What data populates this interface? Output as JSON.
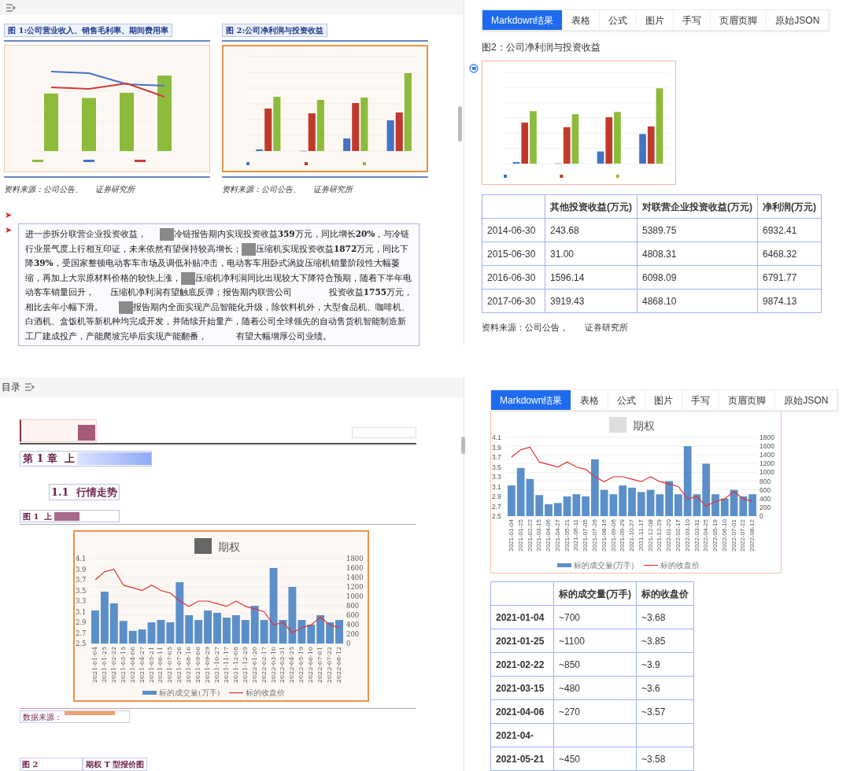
{
  "top_left": {
    "figures": [
      {
        "kind": "combo",
        "title": "图 1:公司营业收入、销售毛利率、期间费用率",
        "source": "资料来源：公司公告、     证券研究所"
      },
      {
        "kind": "bar",
        "title": "图 2:公司净利润与投资收益",
        "source": "资料来源：公司公告、     证券研究所"
      }
    ],
    "bullets": [
      {
        "marker": "➤"
      },
      {
        "marker": "➤",
        "segments": [
          {
            "kind": "text",
            "text": "进一步拆分联营企业投资收益，     "
          },
          {
            "kind": "redacted"
          },
          {
            "kind": "text",
            "text": "冷链报告期内实现投资收益**359**万元，同比增长**20%**，与冷链行业景气度上行相互印证，未来依然有望保持较高增长；"
          },
          {
            "kind": "redacted"
          },
          {
            "kind": "text",
            "text": "压缩机实现投资收益**1872**万元，同比下降**39%**，受国家整顿电动客车市场及调低补贴冲击，电动客车用卧式涡旋压缩机销量阶段性大幅萎缩，再加上大宗原材料价格的较快上涨，"
          },
          {
            "kind": "redacted"
          },
          {
            "kind": "text",
            "text": "压缩机净利润同比出现较大下降符合预期，随着下半年电动客车销量回升，      压缩机净利润有望触底反弹；报告期内联营公司              投资收益**1755**万元，相比去年小幅下滑。      "
          },
          {
            "kind": "redacted"
          },
          {
            "kind": "text",
            "text": "报告期内全面实现产品智能化升级，除饮料机外，大型食品机、咖啡机、白酒机、盒饭机等新机种均完成开发，并陆续开始量产，随着公司全球领先的自动售货机智能制造新工厂建成投产，产能爬坡完毕后实现产能翻番，           有望大幅增厚公司业绩。"
          }
        ]
      }
    ]
  },
  "top_right": {
    "tabs": [
      {
        "label": "Markdown结果",
        "selected": true
      },
      {
        "label": "表格",
        "selected": false
      },
      {
        "label": "公式",
        "selected": false
      },
      {
        "label": "图片",
        "selected": false
      },
      {
        "label": "手写",
        "selected": false
      },
      {
        "label": "页眉页脚",
        "selected": false
      },
      {
        "label": "原始JSON",
        "selected": false
      }
    ],
    "heading": "图2：公司净利润与投资收益",
    "table": {
      "columns": [
        "其他投资收益(万元)",
        "对联营企业投资收益(万元)",
        "净利润(万元)"
      ],
      "rows": [
        {
          "label": "2014-06-30",
          "cells": [
            "243.68",
            "5389.75",
            "6932.41"
          ]
        },
        {
          "label": "2015-06-30",
          "cells": [
            "31.00",
            "4808.31",
            "6468.32"
          ]
        },
        {
          "label": "2016-06-30",
          "cells": [
            "1596.14",
            "6098.09",
            "6791.77"
          ]
        },
        {
          "label": "2017-06-30",
          "cells": [
            "3919.43",
            "4868.10",
            "9874.13"
          ]
        }
      ]
    },
    "source": "资料来源：公司公告，       证券研究所"
  },
  "bottom_left": {
    "toolbar_title": "目录",
    "chapter": "第 1 章  上",
    "section": "1.1  行情走势",
    "figure_label": "图 1  上",
    "chart": {
      "title": "期权",
      "chart_data": {
        "type": "bar",
        "categories": [
          "2021-01-04",
          "2021-01-25",
          "2021-02-22",
          "2021-03-15",
          "2021-04-06",
          "2021-04-27",
          "2021-05-21",
          "2021-06-11",
          "2021-07-05",
          "2021-07-26",
          "2021-08-16",
          "2021-09-06",
          "2021-09-29",
          "2021-10-27",
          "2021-11-17",
          "2021-12-08",
          "2021-12-29",
          "2022-01-20",
          "2022-02-17",
          "2022-03-10",
          "2022-03-31",
          "2022-04-25",
          "2022-05-19",
          "2022-06-10",
          "2022-07-01",
          "2022-07-22",
          "2022-08-12"
        ],
        "series": [
          {
            "name": "标的成交量(万手)",
            "type": "bar",
            "axis": "y2",
            "color": "#5b8fc9",
            "values": [
              700,
              1100,
              850,
              480,
              270,
              300,
              450,
              500,
              450,
              1300,
              600,
              500,
              700,
              650,
              550,
              600,
              500,
              800,
              500,
              1600,
              500,
              1200,
              500,
              400,
              600,
              450,
              500
            ]
          },
          {
            "name": "标的收盘价",
            "type": "line",
            "color": "#e0322f",
            "values": [
              3.7,
              3.85,
              3.9,
              3.6,
              3.55,
              3.5,
              3.6,
              3.5,
              3.45,
              3.3,
              3.2,
              3.3,
              3.3,
              3.25,
              3.2,
              3.3,
              3.2,
              3.15,
              3.1,
              2.85,
              2.9,
              2.7,
              2.8,
              2.85,
              3.0,
              2.85,
              2.8
            ]
          }
        ],
        "ylim": [
          2.5,
          4.1
        ],
        "yticks": [
          {
            "value": 4.1,
            "label": "4.1"
          },
          {
            "value": 3.9,
            "label": "3.9"
          },
          {
            "value": 3.7,
            "label": "3.7"
          },
          {
            "value": 3.5,
            "label": "3.5"
          },
          {
            "value": 3.3,
            "label": "3.3"
          },
          {
            "value": 3.1,
            "label": "3.1"
          },
          {
            "value": 2.9,
            "label": "2.9"
          },
          {
            "value": 2.7,
            "label": "2.7"
          },
          {
            "value": 2.5,
            "label": "2.5"
          }
        ],
        "y2lim": [
          0,
          1800
        ],
        "y2ticks": [
          {
            "value": 1800,
            "label": "1800"
          },
          {
            "value": 1600,
            "label": "1600"
          },
          {
            "value": 1400,
            "label": "1400"
          },
          {
            "value": 1200,
            "label": "1200"
          },
          {
            "value": 1000,
            "label": "1000"
          },
          {
            "value": 800,
            "label": "800"
          },
          {
            "value": 600,
            "label": "600"
          },
          {
            "value": 400,
            "label": "400"
          },
          {
            "value": 200,
            "label": "200"
          },
          {
            "value": 0,
            "label": "0"
          }
        ],
        "grid": true,
        "legend": "bottom"
      }
    },
    "source": "数据来源：",
    "next_figure": {
      "label": "图 2",
      "title": "期权 T 型报价图"
    }
  },
  "bottom_right": {
    "tabs": [
      {
        "label": "Markdown结果",
        "selected": true
      },
      {
        "label": "表格",
        "selected": false
      },
      {
        "label": "公式",
        "selected": false
      },
      {
        "label": "图片",
        "selected": false
      },
      {
        "label": "手写",
        "selected": false
      },
      {
        "label": "页眉页脚",
        "selected": false
      },
      {
        "label": "原始JSON",
        "selected": false
      }
    ],
    "chart": {
      "title": "期权",
      "chart_data": {
        "type": "bar",
        "categories": [
          "2021-01-04",
          "2021-01-25",
          "2021-02-22",
          "2021-03-15",
          "2021-04-06",
          "2021-04-27",
          "2021-05-21",
          "2021-06-11",
          "2021-07-05",
          "2021-07-26",
          "2021-08-16",
          "2021-09-06",
          "2021-09-29",
          "2021-10-27",
          "2021-11-17",
          "2021-12-08",
          "2021-12-29",
          "2022-01-20",
          "2022-02-17",
          "2022-03-10",
          "2022-03-31",
          "2022-04-25",
          "2022-05-19",
          "2022-06-10",
          "2022-07-01",
          "2022-07-22",
          "2022-08-12"
        ],
        "series": [
          {
            "name": "标的成交量(万手)",
            "type": "bar",
            "axis": "y2",
            "color": "#5b8fc9",
            "values": [
              700,
              1100,
              850,
              480,
              270,
              300,
              450,
              500,
              450,
              1300,
              600,
              500,
              700,
              650,
              550,
              600,
              500,
              800,
              500,
              1600,
              500,
              1200,
              500,
              400,
              600,
              450,
              500
            ]
          },
          {
            "name": "标的收盘价",
            "type": "line",
            "color": "#e0322f",
            "values": [
              3.7,
              3.85,
              3.9,
              3.6,
              3.55,
              3.5,
              3.6,
              3.5,
              3.45,
              3.3,
              3.2,
              3.3,
              3.3,
              3.25,
              3.2,
              3.3,
              3.2,
              3.15,
              3.1,
              2.85,
              2.9,
              2.7,
              2.8,
              2.85,
              3.0,
              2.85,
              2.8
            ]
          }
        ],
        "ylim": [
          2.5,
          4.1
        ],
        "yticks": [
          {
            "value": 4.1,
            "label": "4.1"
          },
          {
            "value": 3.9,
            "label": "3.9"
          },
          {
            "value": 3.7,
            "label": "3.7"
          },
          {
            "value": 3.5,
            "label": "3.5"
          },
          {
            "value": 3.3,
            "label": "3.3"
          },
          {
            "value": 3.1,
            "label": "3.1"
          },
          {
            "value": 2.9,
            "label": "2.9"
          },
          {
            "value": 2.7,
            "label": "2.7"
          },
          {
            "value": 2.5,
            "label": "2.5"
          }
        ],
        "y2lim": [
          0,
          1800
        ],
        "y2ticks": [
          {
            "value": 1800,
            "label": "1800"
          },
          {
            "value": 1600,
            "label": "1600"
          },
          {
            "value": 1400,
            "label": "1400"
          },
          {
            "value": 1200,
            "label": "1200"
          },
          {
            "value": 1000,
            "label": "1000"
          },
          {
            "value": 800,
            "label": "800"
          },
          {
            "value": 600,
            "label": "600"
          },
          {
            "value": 400,
            "label": "400"
          },
          {
            "value": 200,
            "label": "200"
          },
          {
            "value": 0,
            "label": "0"
          }
        ],
        "grid": true,
        "legend": "bottom"
      }
    },
    "table": {
      "columns": [
        "标的成交量(万手)",
        "标的收盘价"
      ],
      "rows": [
        {
          "label": "2021-01-04",
          "cells": [
            "~700",
            "~3.68"
          ]
        },
        {
          "label": "2021-01-25",
          "cells": [
            "~1100",
            "~3.85"
          ]
        },
        {
          "label": "2021-02-22",
          "cells": [
            "~850",
            "~3.9"
          ]
        },
        {
          "label": "2021-03-15",
          "cells": [
            "~480",
            "~3.6"
          ]
        },
        {
          "label": "2021-04-06",
          "cells": [
            "~270",
            "~3.57"
          ]
        },
        {
          "label": "2021-04-",
          "cells": []
        },
        {
          "label": "2021-05-21",
          "cells": [
            "~450",
            "~3.58"
          ]
        }
      ]
    }
  }
}
